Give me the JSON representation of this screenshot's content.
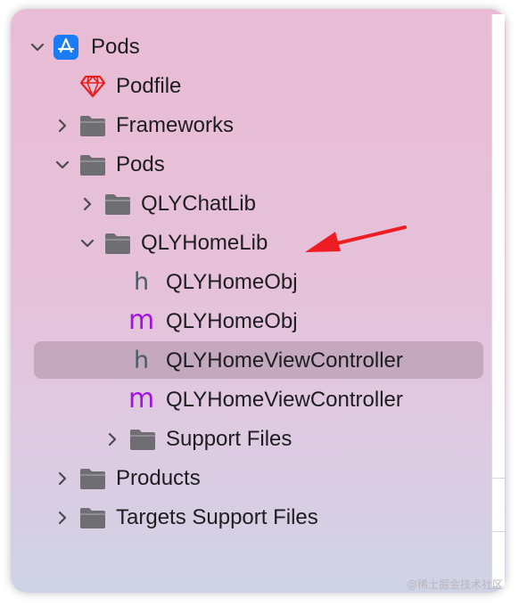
{
  "tree": {
    "items": [
      {
        "label": "Pods",
        "icon": "app-store-icon",
        "expanded": true,
        "level": 0
      },
      {
        "label": "Podfile",
        "icon": "ruby-gem-icon",
        "level": 1
      },
      {
        "label": "Frameworks",
        "icon": "folder-icon",
        "expanded": false,
        "level": 1
      },
      {
        "label": "Pods",
        "icon": "folder-icon",
        "expanded": true,
        "level": 1
      },
      {
        "label": "QLYChatLib",
        "icon": "folder-icon",
        "expanded": false,
        "level": 2
      },
      {
        "label": "QLYHomeLib",
        "icon": "folder-icon",
        "expanded": true,
        "level": 2
      },
      {
        "label": "QLYHomeObj",
        "icon": "header-file-icon",
        "glyph": "h",
        "level": 3
      },
      {
        "label": "QLYHomeObj",
        "icon": "objc-source-file-icon",
        "glyph": "m",
        "level": 3
      },
      {
        "label": "QLYHomeViewController",
        "icon": "header-file-icon",
        "glyph": "h",
        "level": 3,
        "selected": true
      },
      {
        "label": "QLYHomeViewController",
        "icon": "objc-source-file-icon",
        "glyph": "m",
        "level": 3
      },
      {
        "label": "Support Files",
        "icon": "folder-icon",
        "expanded": false,
        "level": 3
      },
      {
        "label": "Products",
        "icon": "folder-icon",
        "expanded": false,
        "level": 1
      },
      {
        "label": "Targets Support Files",
        "icon": "folder-icon",
        "expanded": false,
        "level": 1
      }
    ]
  },
  "colors": {
    "folder": "#6e6e73",
    "header_glyph": "#4a5a6c",
    "source_glyph": "#a213e0",
    "gem": "#e5211d",
    "app_icon": "#1a7cf5",
    "arrow": "#ee1d24"
  },
  "watermark": "@稀土掘金技术社区"
}
